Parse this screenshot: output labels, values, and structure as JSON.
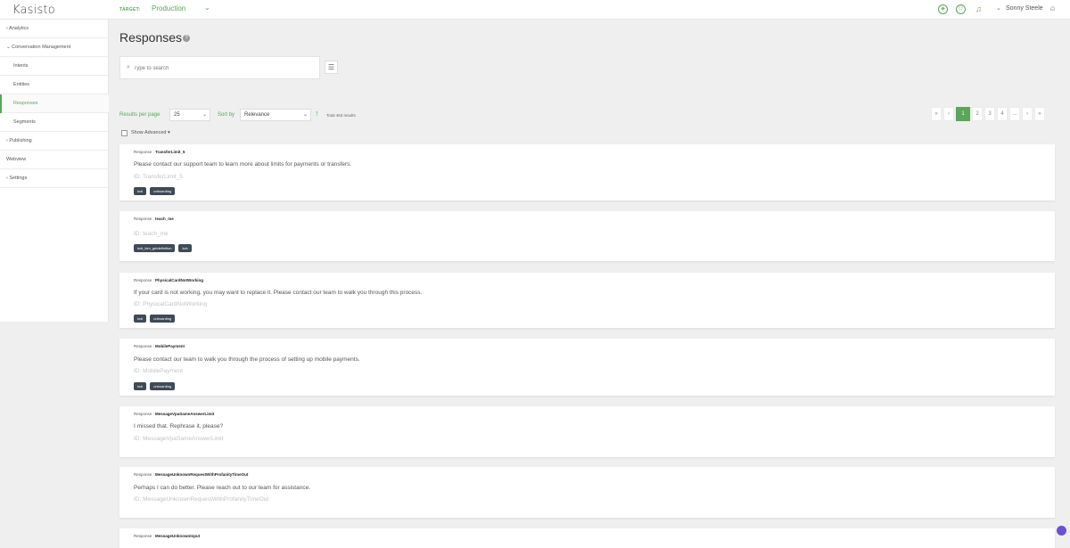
{
  "header": {
    "logo": "Kasisto",
    "target_label": "TARGET:",
    "target_value": "Production",
    "user_name": "Sonny Steele",
    "icons": [
      "cube-icon",
      "person-circle-icon",
      "bell-icon",
      "user-icon"
    ]
  },
  "sidebar": {
    "items": [
      {
        "label": "› Analytics"
      },
      {
        "label": "⌄ Conversation Management"
      },
      {
        "label": "Intents"
      },
      {
        "label": "Entities"
      },
      {
        "label": "Responses"
      },
      {
        "label": "Segments"
      },
      {
        "label": "› Publishing"
      },
      {
        "label": "Webview"
      },
      {
        "label": "› Settings"
      }
    ],
    "active_index": 4
  },
  "main": {
    "title": "Responses",
    "search_placeholder": "Type to search",
    "results_per_page_label": "Results per page",
    "results_per_page_value": "25",
    "sort_by_label": "Sort by",
    "sort_by_value": "Relevance",
    "total_results": "Total 463 results",
    "show_advanced_label": "Show Advanced",
    "show_advanced_checked": false,
    "pagination": [
      "«",
      "‹",
      "1",
      "2",
      "3",
      "4",
      "...",
      "›",
      "»"
    ],
    "current_page": "1"
  },
  "responses": [
    {
      "prefix": "Response : ",
      "name": "TransferLimit_5",
      "text": "Please contact our support team to learn more about limits for payments or transfers.",
      "id_text": "ID: TransferLimit_5",
      "tags": [
        "kcb",
        "onboarding"
      ]
    },
    {
      "prefix": "Response : ",
      "name": "teach_me",
      "text": "",
      "id_text": "ID: teach_me",
      "tags": [
        "kcb_kim_getdefinition",
        "kcb"
      ]
    },
    {
      "prefix": "Response : ",
      "name": "PhysicalCardNotWorking",
      "text": "If your card is not working, you may want to replace it. Please contact our team to walk you through this process.",
      "id_text": "ID: PhysicalCardNotWorking",
      "tags": [
        "kcb",
        "onboarding"
      ]
    },
    {
      "prefix": "Response : ",
      "name": "MobilePayment",
      "text": "Please contact our team to walk you through the process of setting up mobile payments.",
      "id_text": "ID: MobilePayment",
      "tags": [
        "kcb",
        "onboarding"
      ]
    },
    {
      "prefix": "Response : ",
      "name": "MessageVpaSameAnswerLimit",
      "text": "I missed that. Rephrase it, please?",
      "id_text": "ID: MessageVpaSameAnswerLimit",
      "tags": []
    },
    {
      "prefix": "Response : ",
      "name": "MessageUnknownRequestWithProfanityTimeOut",
      "text": "Perhaps I can do better. Please reach out to our team for assistance.",
      "id_text": "ID: MessageUnknownRequestWithProfanityTimeOut",
      "tags": []
    },
    {
      "prefix": "Response : ",
      "name": "MessageUnknownInput",
      "text": "",
      "id_text": "",
      "tags": []
    }
  ],
  "colors": {
    "accent": "#5aa65a",
    "tag_bg": "#3f4a57",
    "page_bg": "#efefef"
  }
}
